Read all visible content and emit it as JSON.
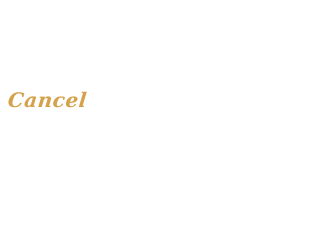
{
  "button": {
    "label": "Cancel",
    "color": "#d4a24a"
  },
  "background": "#ffffff"
}
